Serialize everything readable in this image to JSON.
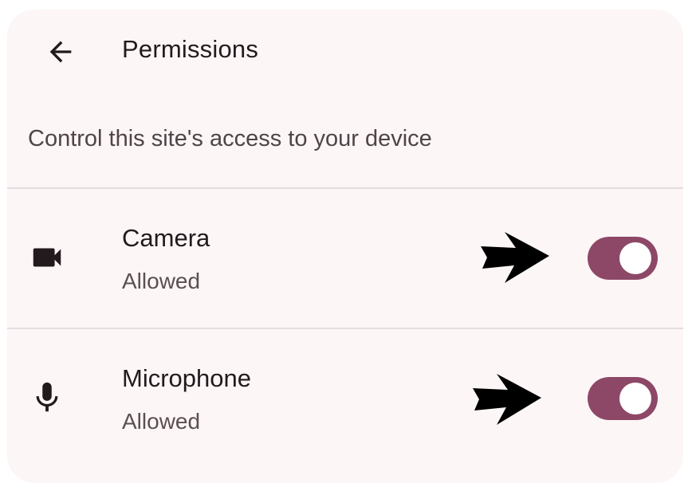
{
  "header": {
    "title": "Permissions",
    "back_icon": "arrow-back-icon"
  },
  "subtitle": "Control this site's access to your device",
  "permissions": [
    {
      "name": "Camera",
      "status": "Allowed",
      "icon": "videocam-icon",
      "enabled": true
    },
    {
      "name": "Microphone",
      "status": "Allowed",
      "icon": "mic-icon",
      "enabled": true
    }
  ],
  "annotations": {
    "pointer_icon": "right-arrow-pointer-icon"
  },
  "colors": {
    "background": "#fdf6f6",
    "toggle_on": "#8d4867",
    "text_primary": "#221a1d",
    "text_secondary": "#5a4f53"
  }
}
